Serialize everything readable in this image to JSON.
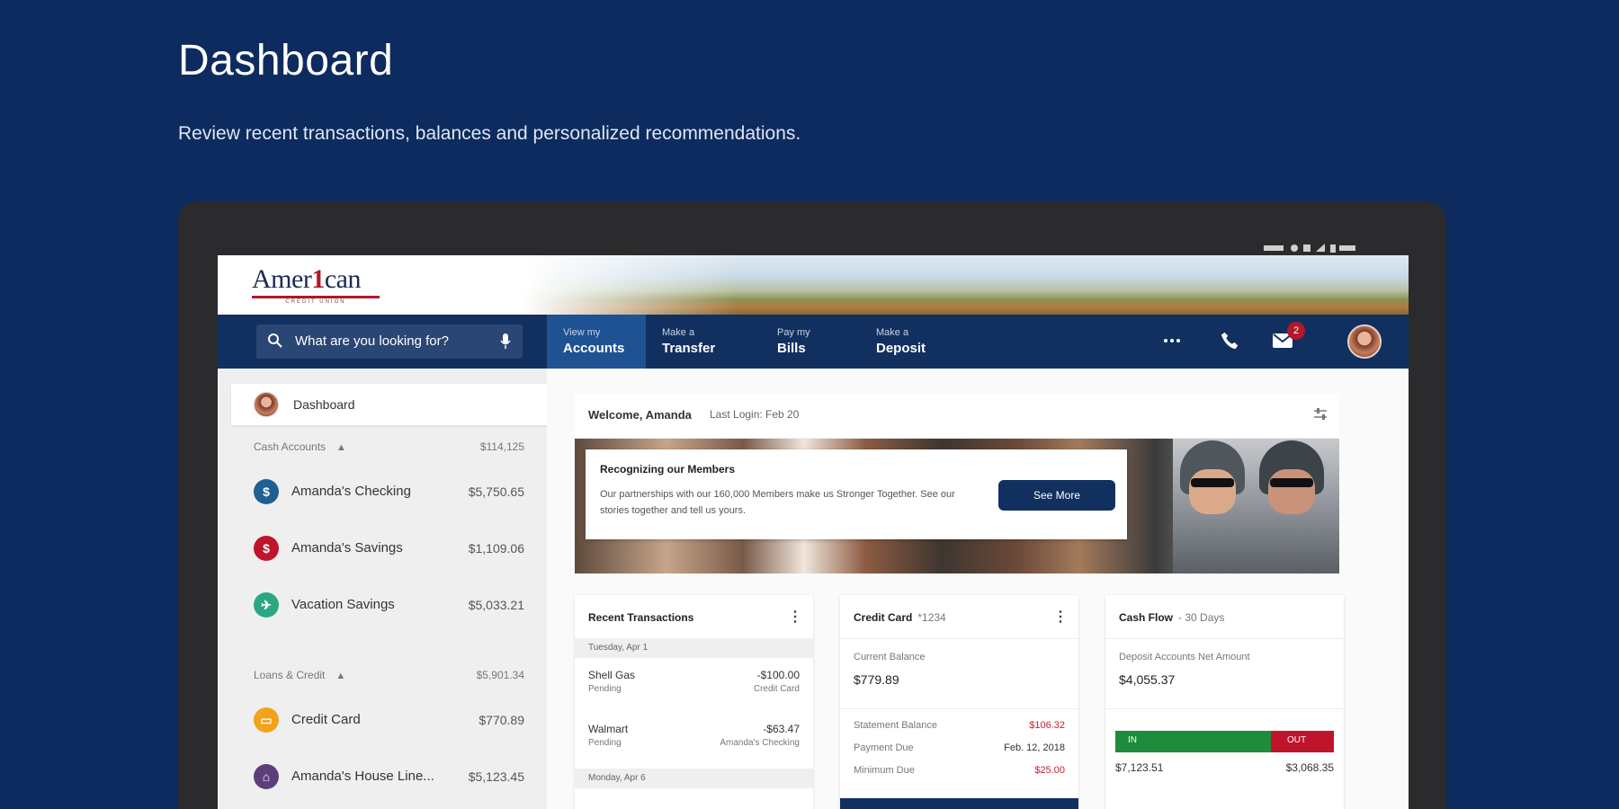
{
  "hero": {
    "title": "Dashboard",
    "subtitle": "Review recent transactions, balances and personalized recommendations."
  },
  "status_bar": "",
  "logo": {
    "name_part1": "Amer",
    "name_part2": "1",
    "name_part3": "can",
    "tagline": "CREDIT UNION"
  },
  "nav": {
    "search_placeholder": "What are you looking for?",
    "tabs": [
      {
        "small": "View my",
        "big": "Accounts",
        "active": true
      },
      {
        "small": "Make a",
        "big": "Transfer",
        "active": false
      },
      {
        "small": "Pay my",
        "big": "Bills",
        "active": false
      },
      {
        "small": "Make a",
        "big": "Deposit",
        "active": false
      }
    ],
    "mail_badge": "2"
  },
  "sidebar": {
    "dashboard_label": "Dashboard",
    "groups": [
      {
        "label": "Cash Accounts",
        "total": "$114,125"
      },
      {
        "label": "Loans & Credit",
        "total": "$5,901.34"
      }
    ],
    "accounts": [
      {
        "name": "Amanda's Checking",
        "amount": "$5,750.65",
        "color": "#1f5f93",
        "icon": "$"
      },
      {
        "name": "Amanda's Savings",
        "amount": "$1,109.06",
        "color": "#c0142a",
        "icon": "$"
      },
      {
        "name": "Vacation Savings",
        "amount": "$5,033.21",
        "color": "#2aa883",
        "icon": "✈"
      },
      {
        "name": "Credit Card",
        "amount": "$770.89",
        "color": "#f2a21b",
        "icon": "▭"
      },
      {
        "name": "Amanda's House Line...",
        "amount": "$5,123.45",
        "color": "#5c3f7a",
        "icon": "⌂"
      }
    ]
  },
  "welcome": {
    "greeting": "Welcome, Amanda",
    "last_login": "Last Login: Feb 20"
  },
  "promo": {
    "title": "Recognizing our Members",
    "description": "Our partnerships with our 160,000 Members make us Stronger Together. See our stories together and tell us yours.",
    "button": "See More"
  },
  "recent_transactions": {
    "title": "Recent Transactions",
    "days": [
      "Tuesday, Apr 1",
      "Monday, Apr 6"
    ],
    "items": [
      {
        "name": "Shell Gas",
        "status": "Pending",
        "amount": "-$100.00",
        "account": "Credit Card"
      },
      {
        "name": "Walmart",
        "status": "Pending",
        "amount": "-$63.47",
        "account": "Amanda's Checking"
      }
    ]
  },
  "credit_card": {
    "title": "Credit Card",
    "suffix": "*1234",
    "current_balance_label": "Current Balance",
    "current_balance": "$779.89",
    "rows": [
      {
        "label": "Statement Balance",
        "value": "$106.32",
        "red": true
      },
      {
        "label": "Payment Due",
        "value": "Feb. 12, 2018",
        "red": false
      },
      {
        "label": "Minimum Due",
        "value": "$25.00",
        "red": true
      }
    ]
  },
  "cash_flow": {
    "title": "Cash Flow",
    "suffix": "- 30 Days",
    "net_label": "Deposit Accounts Net Amount",
    "net_amount": "$4,055.37",
    "in_label": "IN",
    "out_label": "OUT",
    "in_amount": "$7,123.51",
    "out_amount": "$3,068.35",
    "in_fraction": 0.71
  }
}
